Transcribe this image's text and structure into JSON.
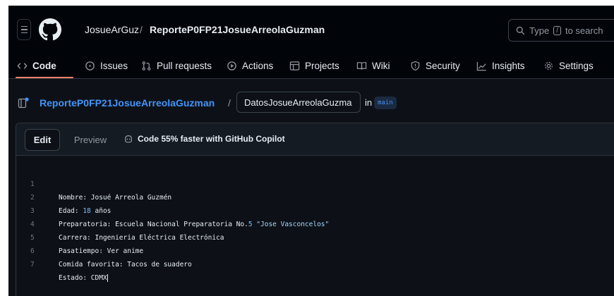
{
  "header": {
    "owner": "JosueArGuz",
    "separator": "/",
    "repo": "ReporteP0FP21JosueArreolaGuzman",
    "search_prefix": "Type",
    "search_key": "/",
    "search_suffix": "to search"
  },
  "nav": {
    "items": [
      {
        "label": "Code",
        "icon": "code-icon"
      },
      {
        "label": "Issues",
        "icon": "issue-icon"
      },
      {
        "label": "Pull requests",
        "icon": "pull-request-icon"
      },
      {
        "label": "Actions",
        "icon": "play-icon"
      },
      {
        "label": "Projects",
        "icon": "table-icon"
      },
      {
        "label": "Wiki",
        "icon": "book-icon"
      },
      {
        "label": "Security",
        "icon": "shield-icon"
      },
      {
        "label": "Insights",
        "icon": "graph-icon"
      },
      {
        "label": "Settings",
        "icon": "gear-icon"
      }
    ]
  },
  "file": {
    "repo_link": "ReporteP0FP21JosueArreolaGuzman",
    "slash": "/",
    "filename": "DatosJosueArreolaGuzma",
    "in_label": "in",
    "branch": "main"
  },
  "editor": {
    "edit_tab": "Edit",
    "preview_tab": "Preview",
    "copilot": "Code 55% faster with GitHub Copilot",
    "lines": [
      {
        "n": "1",
        "a": "Nombre: Josué Arreola Guzmén",
        "num": "",
        "b": "",
        "str": ""
      },
      {
        "n": "2",
        "a": "Edad: ",
        "num": "18",
        "b": " años",
        "str": ""
      },
      {
        "n": "3",
        "a": "Preparatoria: Escuela Nacional Preparatoria No.",
        "num": "5",
        "b": " ",
        "str": "\"Jose Vasconcelos\""
      },
      {
        "n": "4",
        "a": "Carrera: Ingenieria Eléctrica Electrónica",
        "num": "",
        "b": "",
        "str": ""
      },
      {
        "n": "5",
        "a": "Pasatiempo: Ver anime",
        "num": "",
        "b": "",
        "str": ""
      },
      {
        "n": "6",
        "a": "Comida favorita: Tacos de suadero",
        "num": "",
        "b": "",
        "str": ""
      },
      {
        "n": "7",
        "a": "Estado: CDMX",
        "num": "",
        "b": "",
        "str": ""
      }
    ]
  },
  "colors": {
    "background": "#0d1117",
    "header": "#010409",
    "link": "#4493f8",
    "active_underline": "#f78166",
    "number": "#79c0ff",
    "string": "#a5d6ff"
  }
}
